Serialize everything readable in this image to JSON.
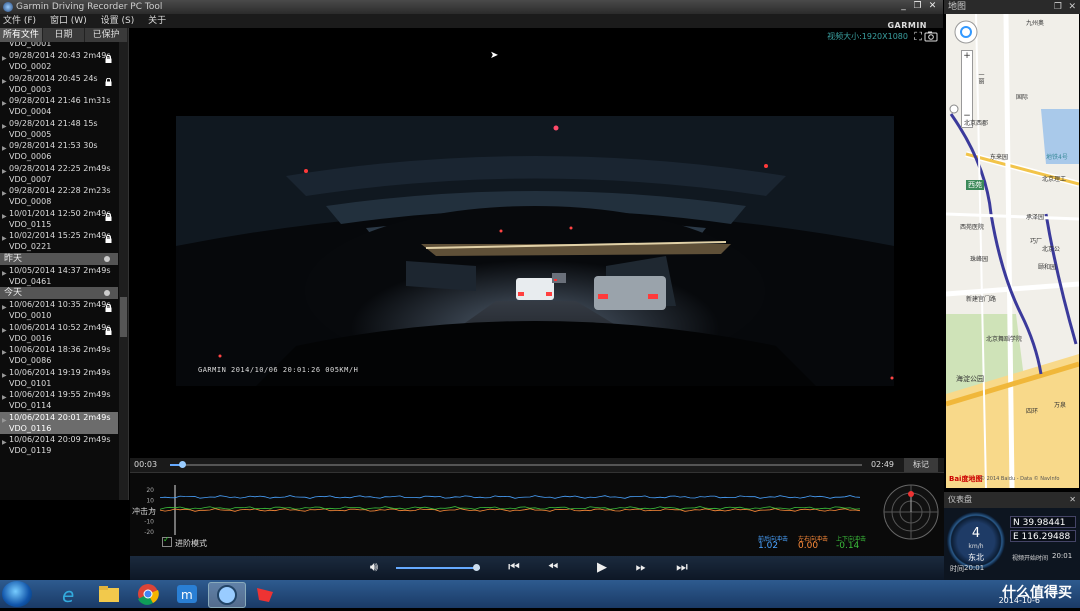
{
  "app": {
    "title": "Garmin Driving Recorder PC Tool",
    "brand": "GARMIN",
    "window_buttons": [
      "_",
      "❐",
      "✕"
    ]
  },
  "menu": [
    "文件 (F)",
    "窗口 (W)",
    "设置 (S)",
    "关于"
  ],
  "tabs": [
    "所有文件",
    "日期",
    "已保护"
  ],
  "file_list": {
    "partial_top": "VDO_0001",
    "older": [
      {
        "date": "09/28/2014 20:43 2m49s",
        "name": "VDO_0002",
        "locked": true
      },
      {
        "date": "09/28/2014 20:45 24s",
        "name": "VDO_0003",
        "locked": true
      },
      {
        "date": "09/28/2014 21:46 1m31s",
        "name": "VDO_0004",
        "locked": false
      },
      {
        "date": "09/28/2014 21:48 15s",
        "name": "VDO_0005",
        "locked": false
      },
      {
        "date": "09/28/2014 21:53 30s",
        "name": "VDO_0006",
        "locked": false
      },
      {
        "date": "09/28/2014 22:25 2m49s",
        "name": "VDO_0007",
        "locked": false
      },
      {
        "date": "09/28/2014 22:28 2m23s",
        "name": "VDO_0008",
        "locked": false
      },
      {
        "date": "10/01/2014 12:50 2m49s",
        "name": "VDO_0115",
        "locked": true
      },
      {
        "date": "10/02/2014 15:25 2m49s",
        "name": "VDO_0221",
        "locked": true
      }
    ],
    "yesterday_label": "昨天",
    "yesterday": [
      {
        "date": "10/05/2014 14:37 2m49s",
        "name": "VDO_0461",
        "locked": false
      }
    ],
    "today_label": "今天",
    "today": [
      {
        "date": "10/06/2014 10:35 2m49s",
        "name": "VDO_0010",
        "locked": true
      },
      {
        "date": "10/06/2014 10:52 2m49s",
        "name": "VDO_0016",
        "locked": true
      },
      {
        "date": "10/06/2014 18:36 2m49s",
        "name": "VDO_0086",
        "locked": false
      },
      {
        "date": "10/06/2014 19:19 2m49s",
        "name": "VDO_0101",
        "locked": false
      },
      {
        "date": "10/06/2014 19:55 2m49s",
        "name": "VDO_0114",
        "locked": false
      },
      {
        "date": "10/06/2014 20:01 2m49s",
        "name": "VDO_0116",
        "locked": false,
        "selected": true
      },
      {
        "date": "10/06/2014 20:09 2m49s",
        "name": "VDO_0119",
        "locked": false
      }
    ]
  },
  "video": {
    "size_label": "视频大小:1920X1080",
    "overlay": "GARMIN  2014/10/06  20:01:26  005KM/H"
  },
  "timeline": {
    "current": "00:03",
    "total": "02:49",
    "progress": 0.018,
    "mark_label": "标记"
  },
  "gsensor": {
    "label": "冲击力",
    "y_ticks": [
      "20",
      "10",
      "0",
      "-10",
      "-20"
    ],
    "advanced_mode": "进阶模式",
    "readings": [
      {
        "label": "前后向冲击",
        "value": "1.02",
        "color": "#4aa3ff"
      },
      {
        "label": "左右向冲击",
        "value": "0.00",
        "color": "#ff8c3a"
      },
      {
        "label": "上下向冲击",
        "value": "-0.14",
        "color": "#3bbf3b"
      }
    ]
  },
  "controls": {
    "volume": 0.95
  },
  "map": {
    "title": "地图",
    "labels": [
      "九州奥",
      "一丽",
      "国际",
      "北京西郡",
      "东来园",
      "地铁4号",
      "北京理工",
      "西苑",
      "西苑医院",
      "巧厂",
      "承泽园",
      "北京公",
      "颐和园",
      "珠峰园",
      "北京舞蹈学院",
      "新建宫门路",
      "海淀公园",
      "四环",
      "万泉"
    ],
    "copyright": "© 2014 Baidu - Data © NavInfo",
    "baidu": "Bai度地图"
  },
  "gauge": {
    "title": "仪表盘",
    "speed": "4",
    "unit": "km/h",
    "direction": "东北",
    "lat": "N 39.98441",
    "lon": "E 116.29488",
    "start_label": "视频开始时间",
    "start_time": "20:01",
    "time_label": "时间",
    "time": "20:01"
  },
  "taskbar": {
    "date": "2014-10-6",
    "watermark": "什么值得买"
  }
}
